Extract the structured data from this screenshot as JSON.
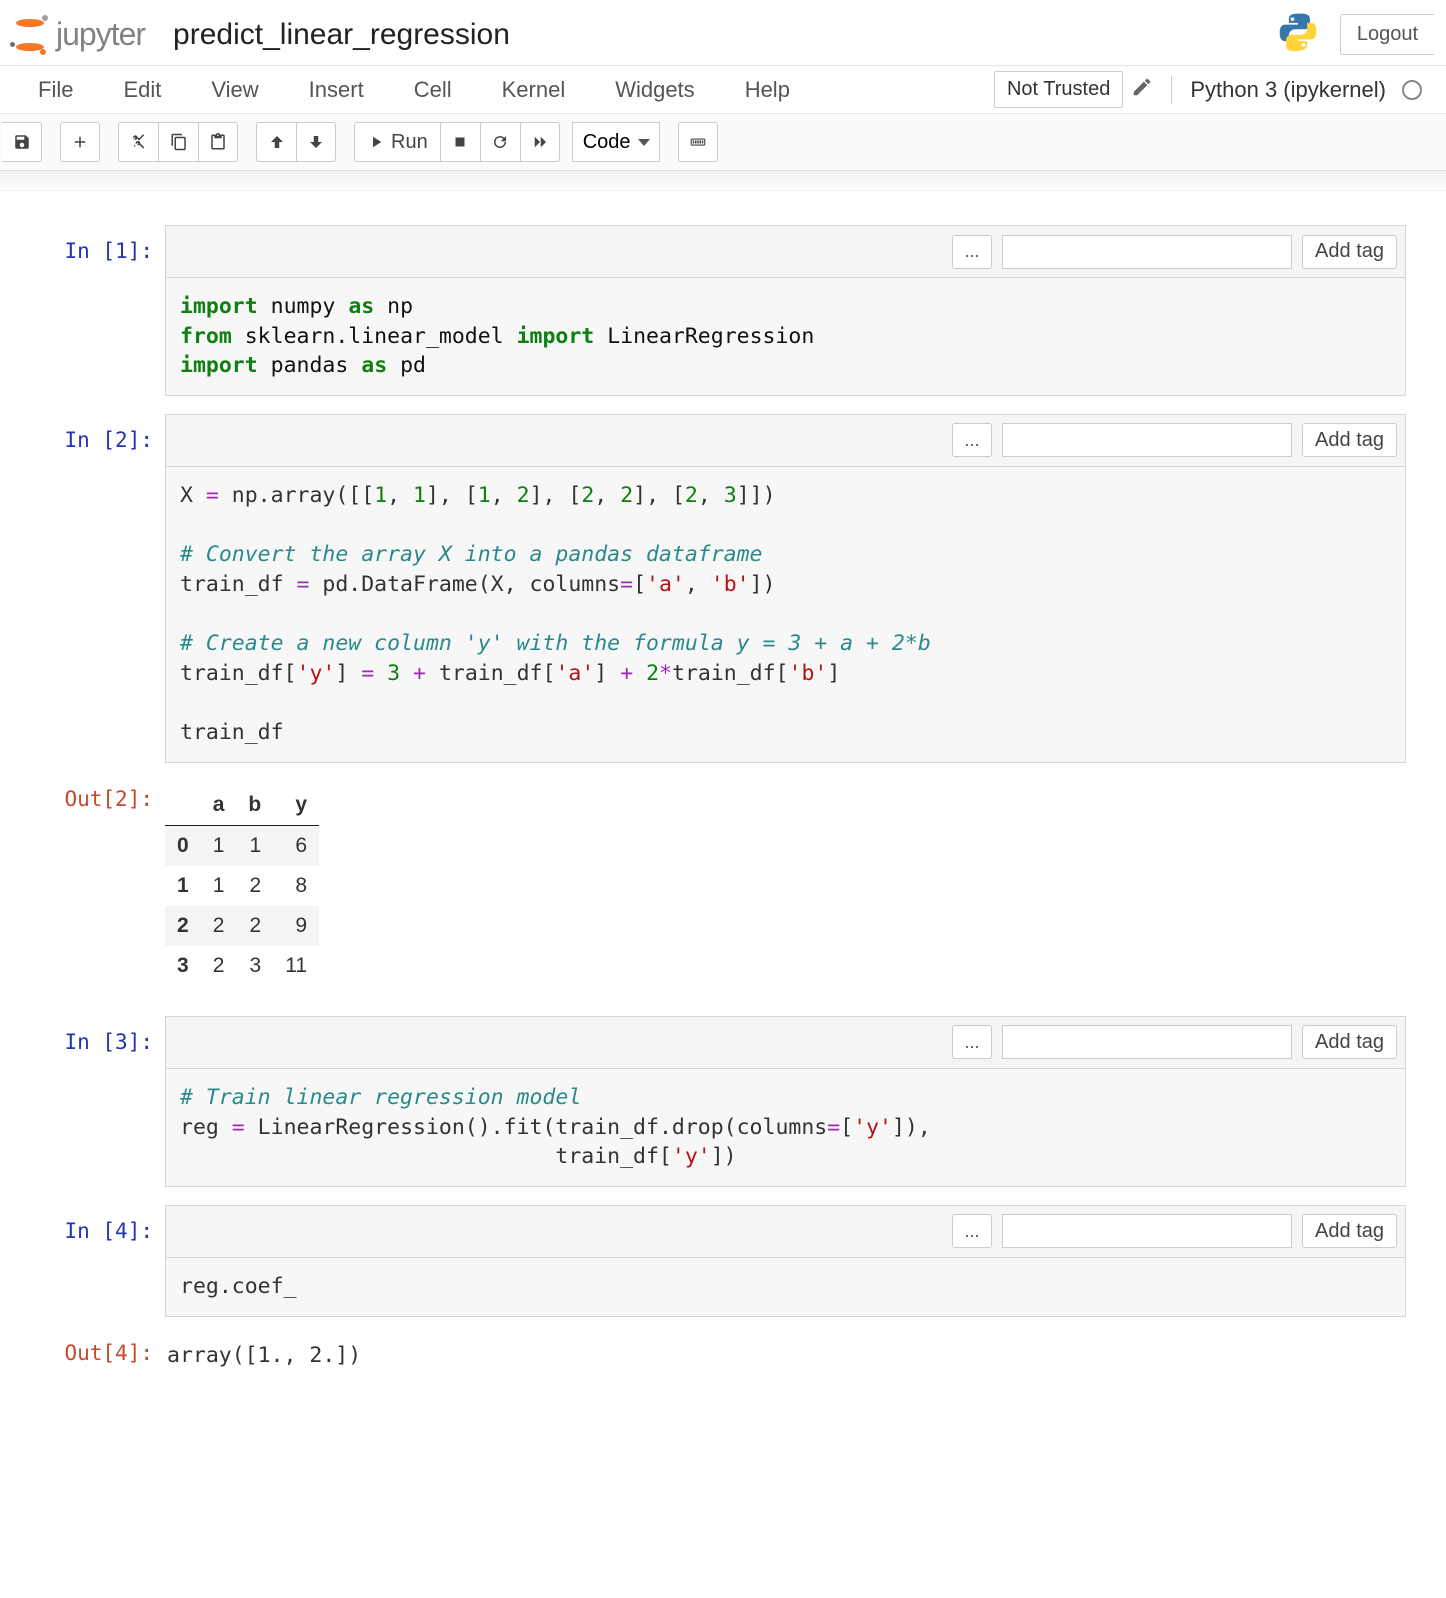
{
  "header": {
    "brand": "jupyter",
    "notebook_title": "predict_linear_regression",
    "logout": "Logout"
  },
  "menubar": {
    "items": [
      "File",
      "Edit",
      "View",
      "Insert",
      "Cell",
      "Kernel",
      "Widgets",
      "Help"
    ],
    "trust": "Not Trusted",
    "kernel": "Python 3 (ipykernel)"
  },
  "toolbar": {
    "run_label": "Run",
    "cell_type_selected": "Code"
  },
  "tagbar": {
    "ellipsis": "...",
    "add_tag": "Add tag",
    "placeholder": ""
  },
  "cells": [
    {
      "prompt_in": "In [1]:",
      "code_html": "<span class='kw'>import</span> <span class='name'>numpy</span> <span class='kw'>as</span> <span class='name'>np</span>\n<span class='kw'>from</span> <span class='name'>sklearn.linear_model</span> <span class='kw'>import</span> <span class='name'>LinearRegression</span>\n<span class='kw'>import</span> <span class='name'>pandas</span> <span class='kw'>as</span> <span class='name'>pd</span>"
    },
    {
      "prompt_in": "In [2]:",
      "code_html": "X <span class='op'>=</span> np.array([[<span class='num'>1</span>, <span class='num'>1</span>], [<span class='num'>1</span>, <span class='num'>2</span>], [<span class='num'>2</span>, <span class='num'>2</span>], [<span class='num'>2</span>, <span class='num'>3</span>]])\n\n<span class='cmnt'># Convert the array X into a pandas dataframe</span>\ntrain_df <span class='op'>=</span> pd.DataFrame(X, columns<span class='op'>=</span>[<span class='str'>'a'</span>, <span class='str'>'b'</span>])\n\n<span class='cmnt'># Create a new column 'y' with the formula y = 3 + a + 2*b</span>\ntrain_df[<span class='str'>'y'</span>] <span class='op'>=</span> <span class='num'>3</span> <span class='op'>+</span> train_df[<span class='str'>'a'</span>] <span class='op'>+</span> <span class='num'>2</span><span class='op'>*</span>train_df[<span class='str'>'b'</span>]\n\ntrain_df",
      "prompt_out": "Out[2]:",
      "output_table": {
        "columns": [
          "a",
          "b",
          "y"
        ],
        "index": [
          "0",
          "1",
          "2",
          "3"
        ],
        "data": [
          [
            "1",
            "1",
            "6"
          ],
          [
            "1",
            "2",
            "8"
          ],
          [
            "2",
            "2",
            "9"
          ],
          [
            "2",
            "3",
            "11"
          ]
        ]
      }
    },
    {
      "prompt_in": "In [3]:",
      "code_html": "<span class='cmnt'># Train linear regression model</span>\nreg <span class='op'>=</span> LinearRegression().fit(train_df.drop(columns<span class='op'>=</span>[<span class='str'>'y'</span>]),\n                             train_df[<span class='str'>'y'</span>])"
    },
    {
      "prompt_in": "In [4]:",
      "code_html": "reg.coef_",
      "prompt_out": "Out[4]:",
      "output_text": "array([1., 2.])"
    }
  ]
}
